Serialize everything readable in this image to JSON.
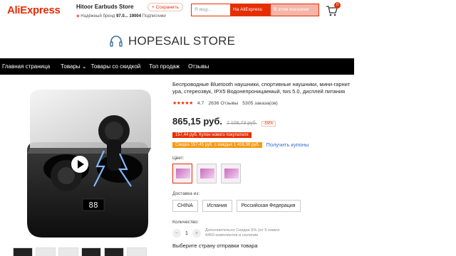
{
  "header": {
    "logo": "AliExpress",
    "store_name": "Hitoor Earbuds Store",
    "save_label": "+ Сохранить",
    "reliable_label": "Надёжный бренд",
    "rating_pct": "97.0...",
    "subscribers_count": "19004",
    "subscribers_label": "Подписчики",
    "search_placeholder": "Я ищу...",
    "search_aliexpress": "На AliExpress",
    "search_store": "В этом магазине",
    "cart_count": "0"
  },
  "banner": {
    "store_title": "HOPESAIL STORE"
  },
  "nav": {
    "items": [
      "Главная страница",
      "Товары",
      "Товары со скидкой",
      "Топ продаж",
      "Отзывы"
    ]
  },
  "product": {
    "title_line1": "Беспроводные Bluetooth наушники, спортивные наушники, мини-гарнит",
    "title_line2": "ура, стереозвук, IPX5 Водонепроницаемый, tws 5.0, дисплей питания",
    "stars": "★★★★★",
    "rating": "4.7",
    "reviews": "2636 Отзывы",
    "orders": "5305 заказа(ов)",
    "price": "865,15 руб.",
    "old_price": "2 109,73 руб.",
    "discount": "-59%",
    "coupon_new": "157,44 руб. Купон нового покупателя",
    "coupon_discount": "Скидка 157,45 руб. с каждых 1 416,98 руб.",
    "get_coupons": "Получить купоны",
    "color_label": "Цвет:",
    "shipping_label": "Доставка из:",
    "shipping_options": [
      "CHINA",
      "Испания",
      "Российская Федерация"
    ],
    "qty_label": "Количество:",
    "qty_minus": "−",
    "qty_value": "1",
    "qty_plus": "+",
    "qty_note_line1": "Дополнительно Скидка 5% (от 5 компл",
    "qty_note_line2": "4450 комплектов в наличии",
    "choose_country": "Выберите страну отправки товара"
  },
  "colors": {
    "brand": "#e62e04",
    "nav_bg": "#000000",
    "coupon_orange": "#f59a13",
    "link": "#2e6bd3"
  }
}
